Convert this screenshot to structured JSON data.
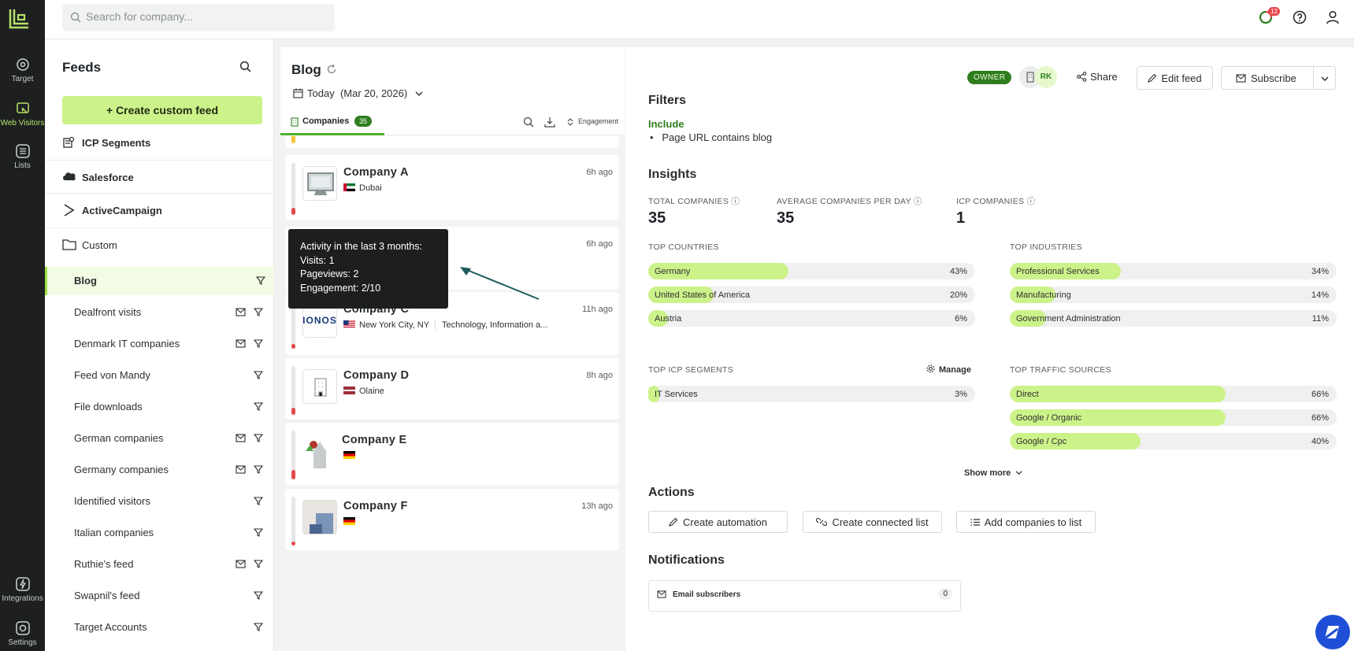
{
  "rail": {
    "items": [
      {
        "label": "Target",
        "icon": "target-icon"
      },
      {
        "label": "Web Visitors",
        "icon": "web-visitors-icon"
      },
      {
        "label": "Lists",
        "icon": "lists-icon"
      },
      {
        "label": "Integrations",
        "icon": "integrations-icon"
      },
      {
        "label": "Settings",
        "icon": "settings-icon"
      }
    ]
  },
  "topbar": {
    "search_placeholder": "Search for company...",
    "notification_count": "12"
  },
  "feeds": {
    "title": "Feeds",
    "create_label": "Create custom feed",
    "groups": [
      "ICP Segments",
      "Salesforce",
      "ActiveCampaign",
      "Custom"
    ],
    "items": [
      {
        "label": "Blog"
      },
      {
        "label": "Dealfront visits"
      },
      {
        "label": "Denmark IT companies"
      },
      {
        "label": "Feed von Mandy"
      },
      {
        "label": "File downloads"
      },
      {
        "label": "German companies"
      },
      {
        "label": "Germany companies"
      },
      {
        "label": "Identified visitors"
      },
      {
        "label": "Italian companies"
      },
      {
        "label": "Ruthie's feed"
      },
      {
        "label": "Swapnil's feed"
      },
      {
        "label": "Target Accounts"
      }
    ]
  },
  "list": {
    "title": "Blog",
    "date_label": "Today",
    "date_value": "(Mar 20, 2026)",
    "tab_label": "Companies",
    "tab_count": "35",
    "engagement_label": "Engagement",
    "companies": [
      {
        "name": "Company A",
        "time": "6h ago",
        "location": "Dubai",
        "industry": ""
      },
      {
        "name": "",
        "time": "6h ago",
        "location": "",
        "industry": ""
      },
      {
        "name": "Company C",
        "time": "11h ago",
        "location": "New York City, NY",
        "industry": "Technology, Information a..."
      },
      {
        "name": "Company D",
        "time": "8h ago",
        "location": "Olaine",
        "industry": ""
      },
      {
        "name": "Company E",
        "time": "",
        "location": "",
        "industry": ""
      },
      {
        "name": "Company F",
        "time": "13h ago",
        "location": "",
        "industry": ""
      }
    ],
    "company_c_logo_text": "IONOS"
  },
  "tooltip": {
    "title": "Activity in the last 3 months:",
    "visits": "Visits: 1",
    "pageviews": "Pageviews: 2",
    "engagement": "Engagement: 2/10"
  },
  "detail": {
    "owner_badge": "OWNER",
    "avatar_initials": "RK",
    "share_label": "Share",
    "edit_label": "Edit feed",
    "subscribe_label": "Subscribe",
    "filters_title": "Filters",
    "include_label": "Include",
    "filter_rule": "Page URL contains blog",
    "insights_title": "Insights",
    "stats": [
      {
        "label": "TOTAL COMPANIES",
        "value": "35"
      },
      {
        "label": "AVERAGE COMPANIES PER DAY",
        "value": "35"
      },
      {
        "label": "ICP COMPANIES",
        "value": "1"
      }
    ],
    "top_countries_label": "TOP COUNTRIES",
    "top_countries": [
      {
        "name": "Germany",
        "pct": "43%",
        "fraction": 0.43
      },
      {
        "name": "United States of America",
        "pct": "20%",
        "fraction": 0.2
      },
      {
        "name": "Austria",
        "pct": "6%",
        "fraction": 0.06
      }
    ],
    "top_industries_label": "TOP INDUSTRIES",
    "top_industries": [
      {
        "name": "Professional Services",
        "pct": "34%",
        "fraction": 0.34
      },
      {
        "name": "Manufacturing",
        "pct": "14%",
        "fraction": 0.14
      },
      {
        "name": "Government Administration",
        "pct": "11%",
        "fraction": 0.11
      }
    ],
    "top_icp_label": "TOP ICP SEGMENTS",
    "manage_label": "Manage",
    "top_icp": [
      {
        "name": "IT Services",
        "pct": "3%",
        "fraction": 0.03
      }
    ],
    "top_traffic_label": "TOP TRAFFIC SOURCES",
    "top_traffic": [
      {
        "name": "Direct",
        "pct": "66%",
        "fraction": 0.66
      },
      {
        "name": "Google / Organic",
        "pct": "66%",
        "fraction": 0.66
      },
      {
        "name": "Google / Cpc",
        "pct": "40%",
        "fraction": 0.4
      }
    ],
    "show_more": "Show more",
    "actions_title": "Actions",
    "actions": [
      "Create automation",
      "Create connected list",
      "Add companies to list"
    ],
    "notifications_title": "Notifications",
    "notif_label": "Email subscribers",
    "notif_count": "0"
  },
  "colors": {
    "accent": "#ccf28a",
    "brand_green": "#2f7d1e",
    "rail_bg": "#1e2020",
    "alert_red": "#e5484d"
  }
}
